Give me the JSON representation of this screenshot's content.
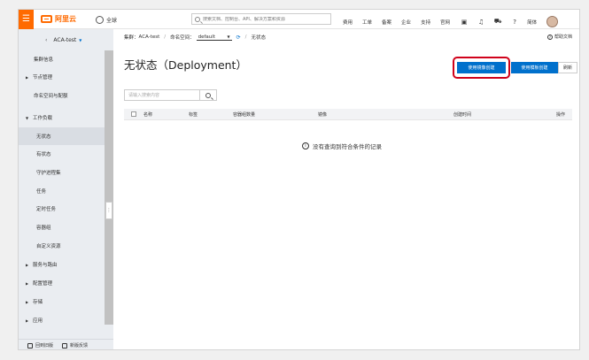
{
  "topbar": {
    "logo_text": "阿里云",
    "region": "全球",
    "search_placeholder": "搜索文档、控制台、API、解决方案和资源",
    "nav": [
      "费用",
      "工单",
      "备案",
      "企业",
      "支持",
      "官网"
    ],
    "lang": "简体"
  },
  "sidebar": {
    "cluster": "ACA-test",
    "items": [
      {
        "label": "集群信息",
        "kind": "lvl0"
      },
      {
        "label": "节点管理",
        "kind": "grp"
      },
      {
        "label": "命名空间与配额",
        "kind": "lvl0"
      },
      {
        "label": "工作负载",
        "kind": "grp-open"
      },
      {
        "label": "无状态",
        "kind": "sub",
        "active": true
      },
      {
        "label": "有状态",
        "kind": "sub"
      },
      {
        "label": "守护进程集",
        "kind": "sub"
      },
      {
        "label": "任务",
        "kind": "sub"
      },
      {
        "label": "定时任务",
        "kind": "sub"
      },
      {
        "label": "容器组",
        "kind": "sub"
      },
      {
        "label": "自定义资源",
        "kind": "sub"
      },
      {
        "label": "服务与路由",
        "kind": "grp"
      },
      {
        "label": "配置管理",
        "kind": "grp"
      },
      {
        "label": "存储",
        "kind": "grp"
      },
      {
        "label": "应用",
        "kind": "grp"
      }
    ],
    "footer": {
      "back": "回到旧版",
      "feedback": "新版反馈"
    }
  },
  "main": {
    "breadcrumb": {
      "cluster_label": "集群",
      "cluster_value": "ACA-test",
      "ns_label": "命名空间",
      "ns_value": "default",
      "page": "无状态"
    },
    "help": "帮助文档",
    "title": "无状态（Deployment）",
    "buttons": {
      "image_create": "使用镜像创建",
      "template_create": "使用模板创建",
      "refresh": "刷新"
    },
    "table_search_placeholder": "请输入搜索内容",
    "columns": [
      "名称",
      "标签",
      "容器组数量",
      "镜像",
      "创建时间",
      "操作"
    ],
    "empty_text": "没有查询到符合条件的记录"
  }
}
